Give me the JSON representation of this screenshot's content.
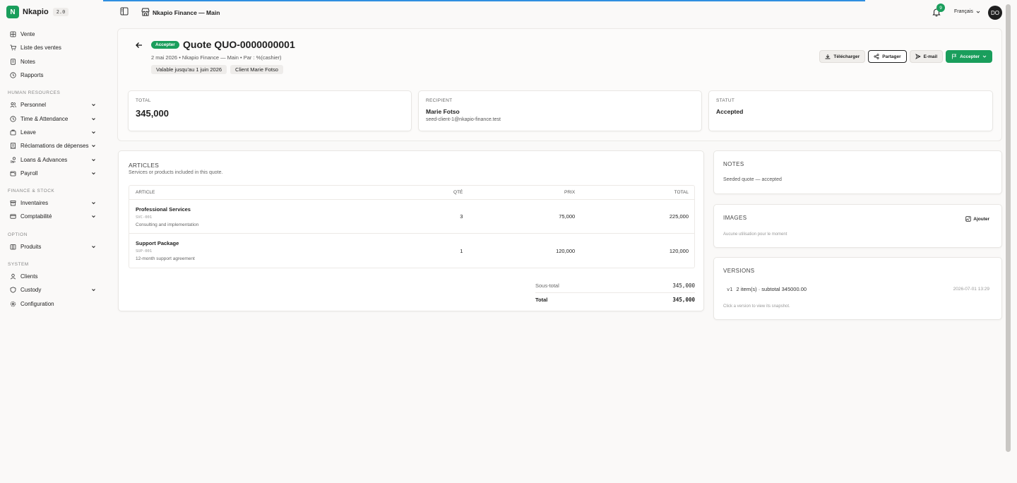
{
  "app": {
    "name": "Nkapio",
    "version": "2.0"
  },
  "sidebar": {
    "items_top": [
      {
        "label": "Vente",
        "icon": "grid-icon"
      },
      {
        "label": "Liste des ventes",
        "icon": "cart-icon"
      },
      {
        "label": "Notes",
        "icon": "note-icon"
      },
      {
        "label": "Rapports",
        "icon": "clock-icon"
      }
    ],
    "sections": [
      {
        "title": "HUMAN RESOURCES",
        "items": [
          {
            "label": "Personnel",
            "icon": "users-icon",
            "expandable": true
          },
          {
            "label": "Time & Attendance",
            "icon": "clock-icon",
            "expandable": true
          },
          {
            "label": "Leave",
            "icon": "suitcase-icon",
            "expandable": true
          },
          {
            "label": "Réclamations de dépenses",
            "icon": "receipt-icon",
            "expandable": true
          },
          {
            "label": "Loans & Advances",
            "icon": "hand-coins-icon",
            "expandable": true
          },
          {
            "label": "Payroll",
            "icon": "wallet-icon",
            "expandable": true
          }
        ]
      },
      {
        "title": "FINANCE & STOCK",
        "items": [
          {
            "label": "Inventaires",
            "icon": "box-icon",
            "expandable": true
          },
          {
            "label": "Comptabilité",
            "icon": "card-icon",
            "expandable": true
          }
        ]
      },
      {
        "title": "OPTION",
        "items": [
          {
            "label": "Produits",
            "icon": "package-icon",
            "expandable": true
          }
        ]
      },
      {
        "title": "SYSTEM",
        "items": [
          {
            "label": "Clients",
            "icon": "user-icon",
            "expandable": false
          },
          {
            "label": "Custody",
            "icon": "shield-icon",
            "expandable": true
          },
          {
            "label": "Configuration",
            "icon": "gear-icon",
            "expandable": false
          }
        ]
      }
    ]
  },
  "header": {
    "store_name": "Nkapio Finance — Main",
    "notifications_count": "9",
    "language": "Français",
    "avatar_initials": "DO"
  },
  "quote": {
    "status": "Accepter",
    "title": "Quote QUO-0000000001",
    "meta": "2 mai 2026 • Nkapio Finance — Main • Par : %(cashier)",
    "chip_valid": "Valable jusqu'au 1 juin 2026",
    "chip_client": "Client Marie Fotso"
  },
  "actions": {
    "download": "Télécharger",
    "share": "Partager",
    "email": "E-mail",
    "accept": "Accepter"
  },
  "stats": {
    "total_label": "TOTAL",
    "total_value": "345,000",
    "recipient_label": "RECIPIENT",
    "recipient_name": "Marie Fotso",
    "recipient_email": "seed-client-1@nkapio-finance.test",
    "status_label": "STATUT",
    "status_value": "Accepted"
  },
  "articles": {
    "title": "ARTICLES",
    "description": "Services or products included in this quote.",
    "columns": {
      "article": "ARTICLE",
      "qty": "QTÉ",
      "price": "PRIX",
      "total": "TOTAL"
    },
    "rows": [
      {
        "name": "Professional Services",
        "sku": "SVC-001",
        "desc": "Consulting and implementation",
        "qty": "3",
        "price": "75,000",
        "total": "225,000"
      },
      {
        "name": "Support Package",
        "sku": "SUP-001",
        "desc": "12-month support agreement",
        "qty": "1",
        "price": "120,000",
        "total": "120,000"
      }
    ],
    "subtotal_label": "Sous-total",
    "subtotal_value": "345,000",
    "total_label": "Total",
    "total_value": "345,000"
  },
  "notes": {
    "title": "NOTES",
    "text": "Seeded quote — accepted"
  },
  "images": {
    "title": "IMAGES",
    "add_label": "Ajouter",
    "empty": "Aucune utilisation pour le moment"
  },
  "versions": {
    "title": "VERSIONS",
    "items": [
      {
        "tag": "v1",
        "summary": "2 item(s) · subtotal 345000.00",
        "date": "2026-07-01 13:29"
      }
    ],
    "hint": "Click a version to view its snapshot."
  },
  "colors": {
    "accent": "#1a9e5c",
    "progress": "#2f8fe0",
    "text": "#1f1f1f"
  }
}
